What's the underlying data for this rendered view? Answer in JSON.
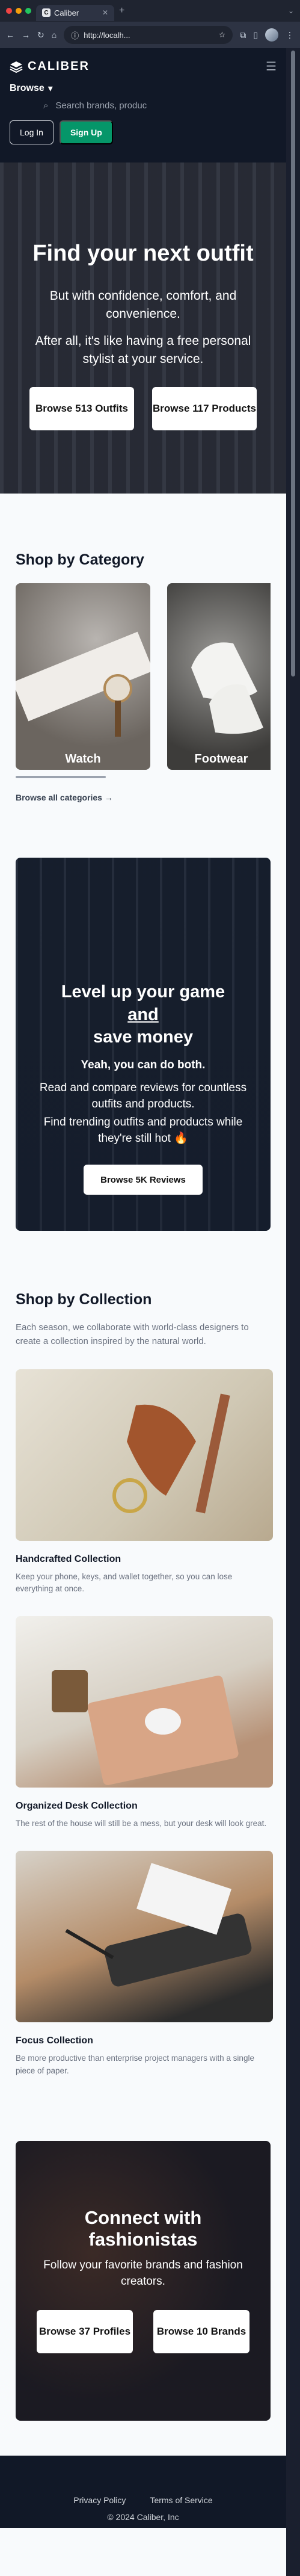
{
  "browser": {
    "tab_title": "Caliber",
    "url": "http://localh...",
    "favicon_letter": "C"
  },
  "header": {
    "logo": "CALIBER",
    "browse": "Browse",
    "search_placeholder": "Search brands, produc",
    "login": "Log In",
    "signup": "Sign Up"
  },
  "hero": {
    "title": "Find your next outfit",
    "line1": "But with confidence, comfort, and convenience.",
    "line2": "After all, it's like having a free personal stylist at your service.",
    "btn_outfits": "Browse 513 Outfits",
    "btn_products": "Browse 117 Products"
  },
  "categories": {
    "title": "Shop by Category",
    "items": [
      {
        "label": "Watch"
      },
      {
        "label": "Footwear"
      }
    ],
    "browse_all": "Browse all categories →"
  },
  "banner": {
    "title_pre": "Level up your game",
    "title_and": "and",
    "title_post": "save money",
    "sub": "Yeah, you can do both.",
    "line1": "Read and compare reviews for countless outfits and products.",
    "line2": "Find trending outfits and products while they're still hot 🔥",
    "cta": "Browse 5K Reviews"
  },
  "collections": {
    "title": "Shop by Collection",
    "desc": "Each season, we collaborate with world-class designers to create a collection inspired by the natural world.",
    "items": [
      {
        "name": "Handcrafted Collection",
        "desc": "Keep your phone, keys, and wallet together, so you can lose everything at once."
      },
      {
        "name": "Organized Desk Collection",
        "desc": "The rest of the house will still be a mess, but your desk will look great."
      },
      {
        "name": "Focus Collection",
        "desc": "Be more productive than enterprise project managers with a single piece of paper."
      }
    ]
  },
  "fashionistas": {
    "title": "Connect with fashionistas",
    "desc": "Follow your favorite brands and fashion creators.",
    "btn_profiles": "Browse 37 Profiles",
    "btn_brands": "Browse 10 Brands"
  },
  "footer": {
    "privacy": "Privacy Policy",
    "terms": "Terms of Service",
    "copyright": "© 2024 Caliber, Inc"
  }
}
